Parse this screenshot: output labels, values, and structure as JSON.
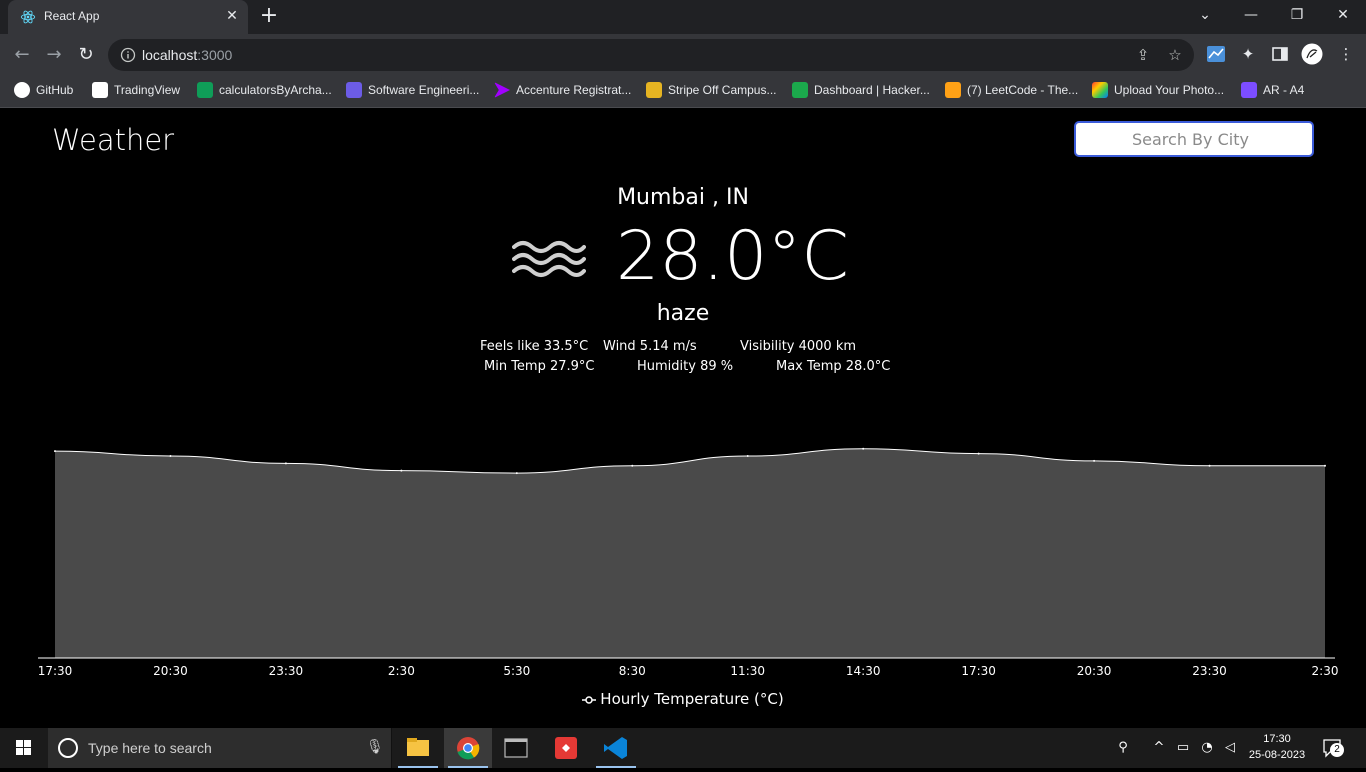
{
  "browser": {
    "tab_title": "React App",
    "url_host": "localhost",
    "url_port": ":3000",
    "bookmarks": [
      {
        "label": "GitHub",
        "icon": "github-icon",
        "color": "#ffffff"
      },
      {
        "label": "TradingView",
        "icon": "tradingview-icon",
        "color": "#ffffff"
      },
      {
        "label": "calculatorsByArcha...",
        "icon": "sheets-icon",
        "color": "#0f9d58"
      },
      {
        "label": "Software Engineeri...",
        "icon": "s-logo-icon",
        "color": "#6c5ce7"
      },
      {
        "label": "Accenture Registrat...",
        "icon": "accenture-icon",
        "color": "#a100ff"
      },
      {
        "label": "Stripe Off Campus...",
        "icon": "stripe-icon",
        "color": "#e6b422"
      },
      {
        "label": "Dashboard | Hacker...",
        "icon": "hackerrank-icon",
        "color": "#1ba94c"
      },
      {
        "label": "(7) LeetCode - The...",
        "icon": "leetcode-icon",
        "color": "#ffa116"
      },
      {
        "label": "Upload Your Photo...",
        "icon": "photo-app-icon",
        "color": "#ff6b00"
      },
      {
        "label": "AR - A4",
        "icon": "printer-icon",
        "color": "#7c4dff"
      }
    ]
  },
  "app": {
    "title": "Weather",
    "search_placeholder": "Search By City",
    "location": "Mumbai , IN",
    "temperature": "28.0°C",
    "description": "haze",
    "weather_icon": "haze-icon",
    "details": {
      "feels_like": "Feels like 33.5°C",
      "wind": "Wind 5.14 m/s",
      "visibility": "Visibility 4000 km",
      "min_temp": "Min Temp 27.9°C",
      "humidity": "Humidity 89 %",
      "max_temp": "Max Temp 28.0°C"
    }
  },
  "chart_data": {
    "type": "area",
    "x": [
      "17:30",
      "20:30",
      "23:30",
      "2:30",
      "5:30",
      "8:30",
      "11:30",
      "14:30",
      "17:30",
      "20:30",
      "23:30",
      "2:30"
    ],
    "series": [
      {
        "name": "Hourly Temperature (°C)",
        "values": [
          28.5,
          28.3,
          28.0,
          27.7,
          27.6,
          27.9,
          28.3,
          28.6,
          28.4,
          28.1,
          27.9,
          27.9
        ]
      }
    ],
    "ylim": [
      20,
      29
    ],
    "grid": false,
    "legend": "bottom",
    "fill_color": "#4a4a4a",
    "line_color": "#ffffff"
  },
  "taskbar": {
    "search_placeholder": "Type here to search",
    "time": "17:30",
    "date": "25-08-2023",
    "notification_count": "2"
  }
}
